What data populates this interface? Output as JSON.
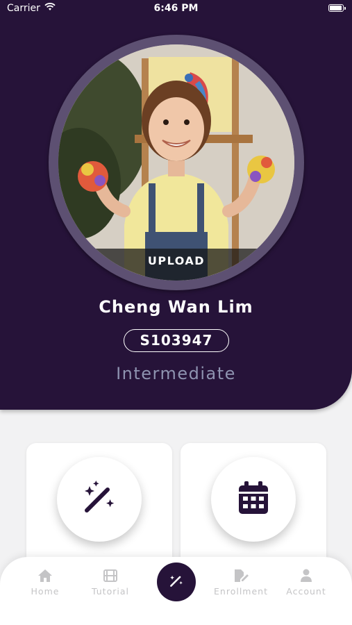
{
  "status_bar": {
    "carrier": "Carrier",
    "time": "6:46 PM"
  },
  "profile": {
    "upload_label": "UPLOAD",
    "name": "Cheng Wan Lim",
    "student_id": "S103947",
    "level": "Intermediate"
  },
  "cards": [
    {
      "icon": "magic-wand-icon"
    },
    {
      "icon": "calendar-icon"
    }
  ],
  "nav": {
    "items": [
      {
        "label": "Home",
        "icon": "home-icon"
      },
      {
        "label": "Tutorial",
        "icon": "film-icon"
      },
      {
        "label": "",
        "icon": "magic-wand-icon"
      },
      {
        "label": "Enrollment",
        "icon": "edit-document-icon"
      },
      {
        "label": "Account",
        "icon": "person-icon"
      }
    ]
  },
  "colors": {
    "brand_dark": "#261339",
    "ring": "#5d5072",
    "level_text": "#8e93b0",
    "nav_inactive": "#c4c4c6"
  }
}
